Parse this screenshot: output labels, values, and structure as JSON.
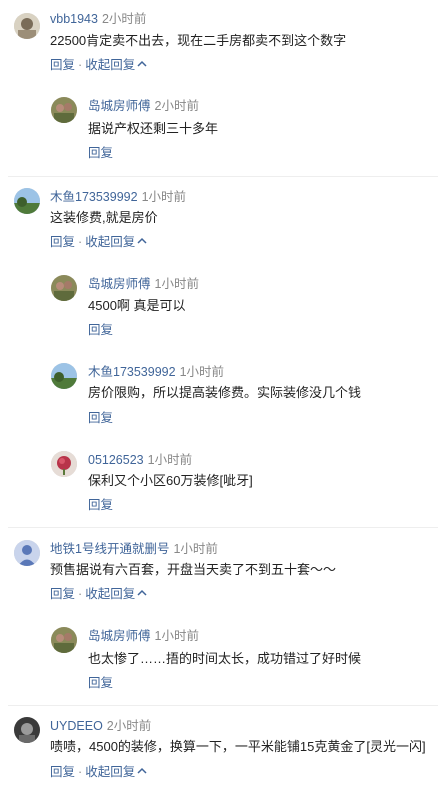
{
  "c1": {
    "user": "vbb1943",
    "time": "2小时前",
    "text": "22500肯定卖不出去，现在二手房都卖不到这个数字",
    "reply": "回复",
    "sep": "·",
    "collapse": "收起回复"
  },
  "r1": {
    "user": "岛城房师傅",
    "time": "2小时前",
    "text": "据说产权还剩三十多年",
    "reply": "回复"
  },
  "c2": {
    "user": "木鱼173539992",
    "time": "1小时前",
    "text": "这装修费,就是房价",
    "reply": "回复",
    "sep": "·",
    "collapse": "收起回复"
  },
  "r2": {
    "user": "岛城房师傅",
    "time": "1小时前",
    "text": "4500啊 真是可以",
    "reply": "回复"
  },
  "r3": {
    "user": "木鱼173539992",
    "time": "1小时前",
    "text": "房价限购，所以提高装修费。实际装修没几个钱",
    "reply": "回复"
  },
  "r4": {
    "user": "05126523",
    "time": "1小时前",
    "text": "保利又个小区60万装修[呲牙]",
    "reply": "回复"
  },
  "c3": {
    "user": "地铁1号线开通就删号",
    "time": "1小时前",
    "text": "预售据说有六百套，开盘当天卖了不到五十套～～",
    "reply": "回复",
    "sep": "·",
    "collapse": "收起回复"
  },
  "r5": {
    "user": "岛城房师傅",
    "time": "1小时前",
    "text": "也太惨了……捂的时间太长，成功错过了好时候",
    "reply": "回复"
  },
  "c4": {
    "user": "UYDEEO",
    "time": "2小时前",
    "text": "啧啧，4500的装修，换算一下，一平米能铺15克黄金了[灵光一闪]",
    "reply": "回复",
    "sep": "·",
    "collapse": "收起回复"
  }
}
